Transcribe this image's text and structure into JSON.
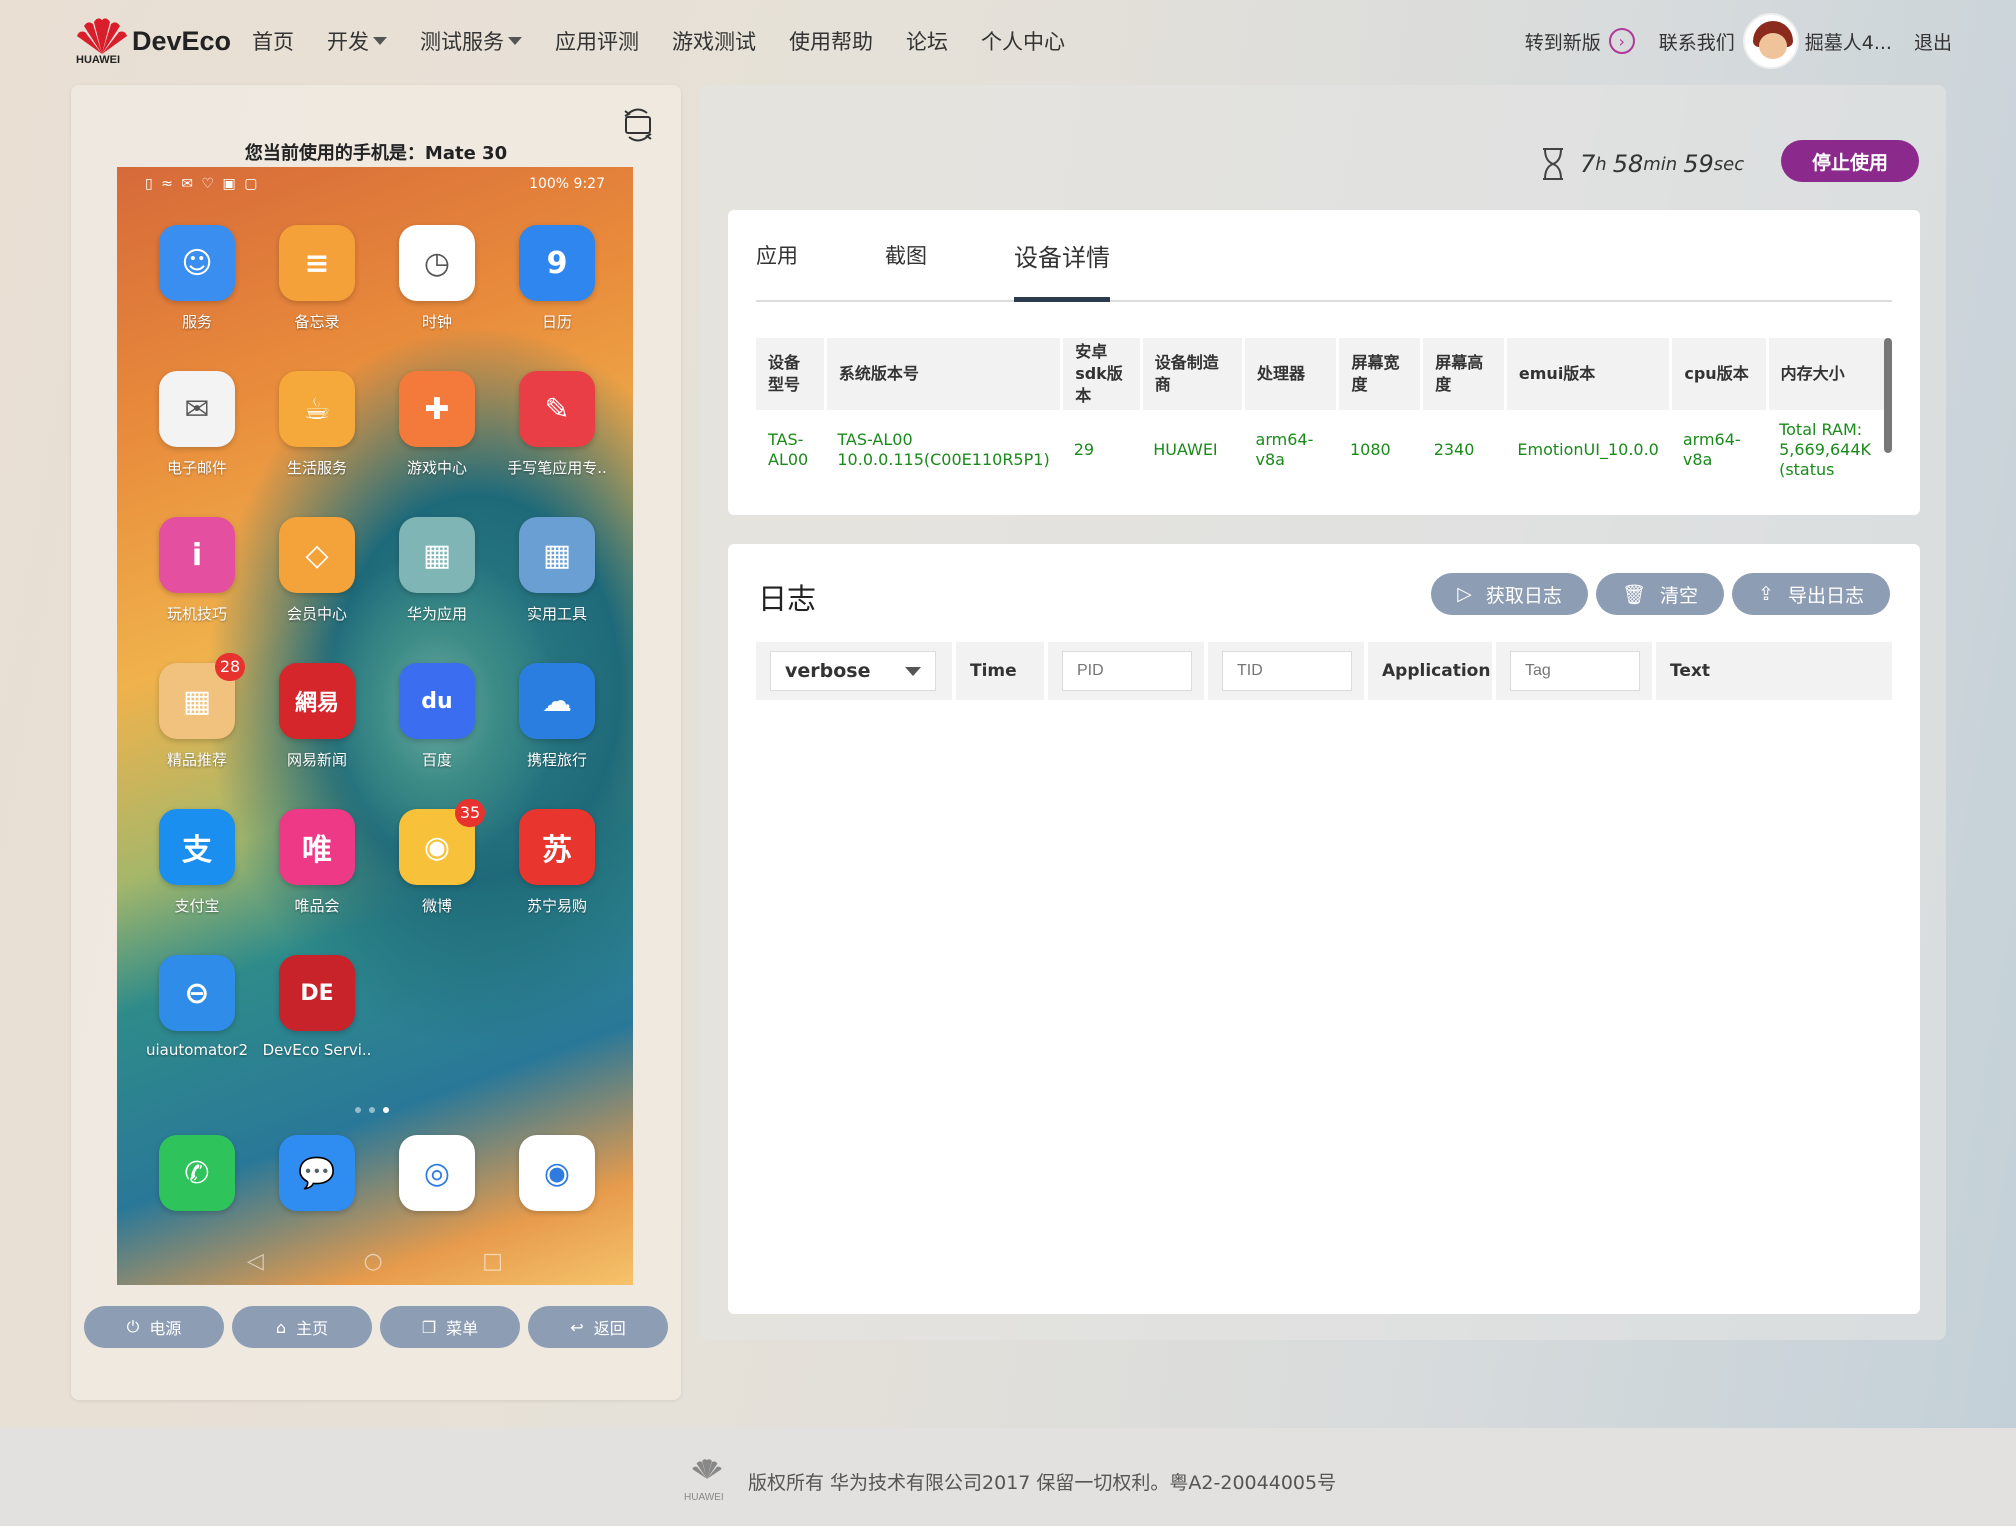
{
  "header": {
    "brand": "DevEco",
    "brand_sub": "HUAWEI",
    "nav": [
      {
        "label": "首页",
        "caret": false
      },
      {
        "label": "开发",
        "caret": true
      },
      {
        "label": "测试服务",
        "caret": true
      },
      {
        "label": "应用评测",
        "caret": false
      },
      {
        "label": "游戏测试",
        "caret": false
      },
      {
        "label": "使用帮助",
        "caret": false
      },
      {
        "label": "论坛",
        "caret": false
      },
      {
        "label": "个人中心",
        "caret": false
      }
    ],
    "switch_new": "转到新版",
    "contact": "联系我们",
    "username": "掘墓人4...",
    "logout": "退出"
  },
  "phone": {
    "caption": "您当前使用的手机是：Mate 30",
    "status_right": "100% 9:27",
    "apps": [
      {
        "label": "服务",
        "color": "#3a8ef0",
        "glyph": "☺"
      },
      {
        "label": "备忘录",
        "color": "#f4a13a",
        "glyph": "≡"
      },
      {
        "label": "时钟",
        "color": "#ffffff",
        "glyph": "◷"
      },
      {
        "label": "日历",
        "color": "#2f86ef",
        "glyph": "9"
      },
      {
        "label": "电子邮件",
        "color": "#f3f3f3",
        "glyph": "✉"
      },
      {
        "label": "生活服务",
        "color": "#f6a93b",
        "glyph": "☕"
      },
      {
        "label": "游戏中心",
        "color": "#f37a3a",
        "glyph": "✚"
      },
      {
        "label": "手写笔应用专..",
        "color": "#ea3e47",
        "glyph": "✎"
      },
      {
        "label": "玩机技巧",
        "color": "#e54fa0",
        "glyph": "i"
      },
      {
        "label": "会员中心",
        "color": "#f4a33b",
        "glyph": "◇"
      },
      {
        "label": "华为应用",
        "color": "#7fb5b5",
        "glyph": "▦"
      },
      {
        "label": "实用工具",
        "color": "#6a9fd4",
        "glyph": "▦"
      },
      {
        "label": "精品推荐",
        "color": "#f1c27d",
        "glyph": "▦",
        "badge": "28"
      },
      {
        "label": "网易新闻",
        "color": "#d4262b",
        "glyph": "網易"
      },
      {
        "label": "百度",
        "color": "#3a6df0",
        "glyph": "du"
      },
      {
        "label": "携程旅行",
        "color": "#2a7ee0",
        "glyph": "☁"
      },
      {
        "label": "支付宝",
        "color": "#1a8ff0",
        "glyph": "支"
      },
      {
        "label": "唯品会",
        "color": "#ee3a86",
        "glyph": "唯"
      },
      {
        "label": "微博",
        "color": "#f7c23a",
        "glyph": "◉",
        "badge": "35"
      },
      {
        "label": "苏宁易购",
        "color": "#e8352d",
        "glyph": "苏"
      },
      {
        "label": "uiautomator2",
        "color": "#2f8ce8",
        "glyph": "⊖"
      },
      {
        "label": "DevEco Servi..",
        "color": "#c8232b",
        "glyph": "DE"
      }
    ],
    "dock": [
      {
        "name": "phone",
        "color": "#2fc35c",
        "glyph": "✆"
      },
      {
        "name": "messages",
        "color": "#2f8cf0",
        "glyph": "💬"
      },
      {
        "name": "browser",
        "color": "#ffffff",
        "glyph": "◎"
      },
      {
        "name": "camera",
        "color": "#ffffff",
        "glyph": "◉"
      }
    ],
    "buttons": {
      "power": "电源",
      "home": "主页",
      "menu": "菜单",
      "back": "返回"
    }
  },
  "session": {
    "hours": "7",
    "h_unit": "h",
    "minutes": "58",
    "min_unit": "min",
    "seconds": "59",
    "sec_unit": "sec",
    "stop_label": "停止使用"
  },
  "details": {
    "tabs": [
      "应用",
      "截图",
      "设备详情"
    ],
    "active_tab": 2,
    "columns": [
      "设备型号",
      "系统版本号",
      "安卓sdk版本",
      "设备制造商",
      "处理器",
      "屏幕宽度",
      "屏幕高度",
      "emui版本",
      "cpu版本",
      "内存大小"
    ],
    "row": {
      "model": "TAS-AL00",
      "system_version": "TAS-AL00 10.0.0.115(C00E110R5P1)",
      "sdk": "29",
      "manufacturer": "HUAWEI",
      "processor": "arm64-v8a",
      "screen_width": "1080",
      "screen_height": "2340",
      "emui": "EmotionUI_10.0.0",
      "cpu": "arm64-v8a",
      "memory": "Total RAM: 5,669,644K (status"
    }
  },
  "log": {
    "title": "日志",
    "fetch": "获取日志",
    "clear": "清空",
    "export": "导出日志",
    "level": "verbose",
    "col_time": "Time",
    "pid_placeholder": "PID",
    "tid_placeholder": "TID",
    "col_application": "Application",
    "tag_placeholder": "Tag",
    "col_text": "Text"
  },
  "footer": {
    "logo_text": "HUAWEI",
    "copyright": "版权所有 华为技术有限公司2017 保留一切权利。粤A2-20044005号"
  }
}
